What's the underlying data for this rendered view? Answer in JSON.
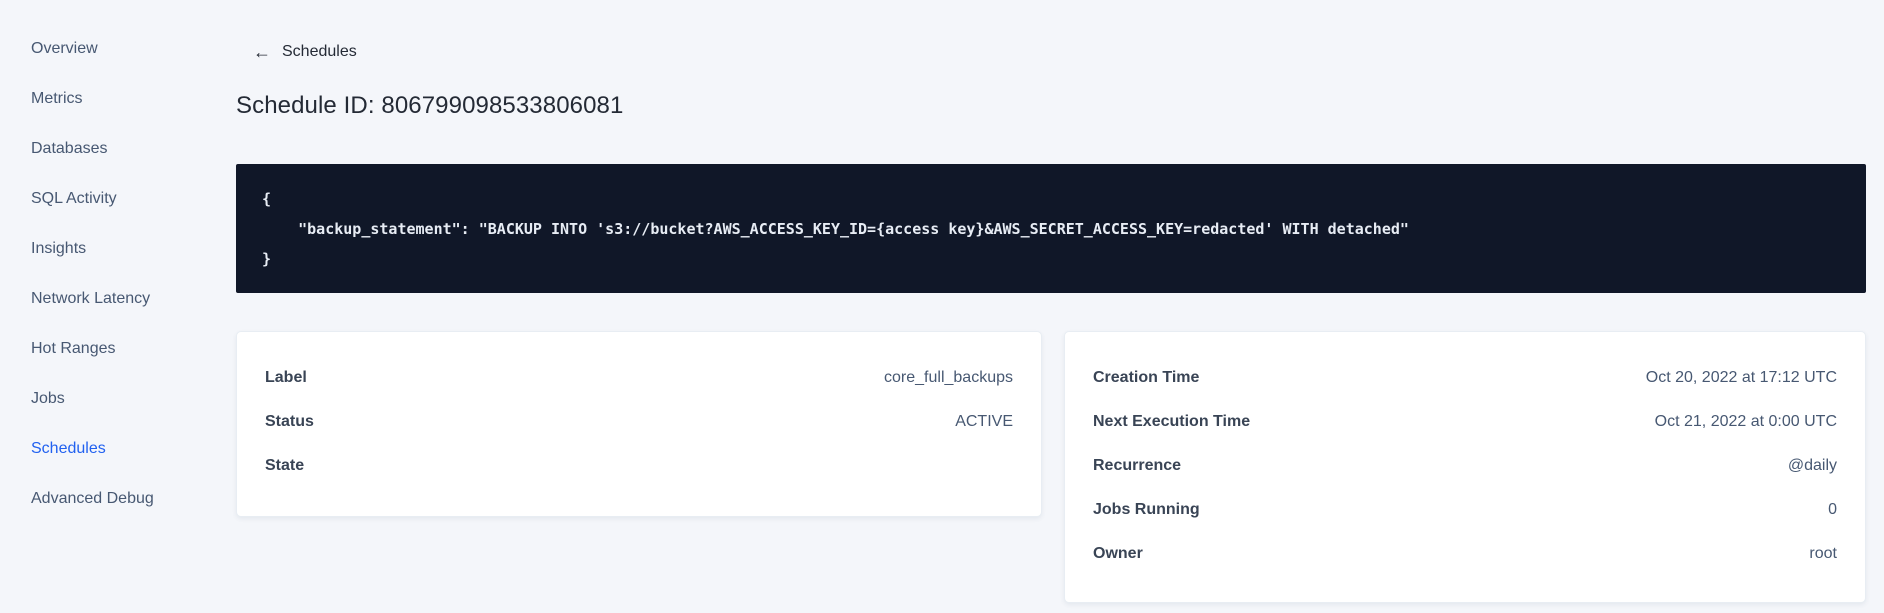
{
  "colors": {
    "accent": "#2161f0",
    "page-bg": "#f4f6fa",
    "code-bg": "#101728",
    "code-text": "#e7ecf4",
    "text-primary": "#242a35",
    "text-secondary": "#475872",
    "text-label": "#394455",
    "card-border": "#e8edf3"
  },
  "sidebar": {
    "items": [
      {
        "label": "Overview",
        "active": false
      },
      {
        "label": "Metrics",
        "active": false
      },
      {
        "label": "Databases",
        "active": false
      },
      {
        "label": "SQL Activity",
        "active": false
      },
      {
        "label": "Insights",
        "active": false
      },
      {
        "label": "Network Latency",
        "active": false
      },
      {
        "label": "Hot Ranges",
        "active": false
      },
      {
        "label": "Jobs",
        "active": false
      },
      {
        "label": "Schedules",
        "active": true
      },
      {
        "label": "Advanced Debug",
        "active": false
      }
    ]
  },
  "header": {
    "back_icon": "←",
    "back_label": "Schedules",
    "title": "Schedule ID: 806799098533806081"
  },
  "code_block": {
    "text": "{\n    \"backup_statement\": \"BACKUP INTO 's3://bucket?AWS_ACCESS_KEY_ID={access key}&AWS_SECRET_ACCESS_KEY=redacted' WITH detached\"\n}"
  },
  "schedule_details": {
    "rows": [
      {
        "label": "Label",
        "value": "core_full_backups"
      },
      {
        "label": "Status",
        "value": "ACTIVE"
      },
      {
        "label": "State",
        "value": ""
      }
    ]
  },
  "execution_details": {
    "rows": [
      {
        "label": "Creation Time",
        "value": "Oct 20, 2022 at 17:12 UTC"
      },
      {
        "label": "Next Execution Time",
        "value": "Oct 21, 2022 at 0:00 UTC"
      },
      {
        "label": "Recurrence",
        "value": "@daily"
      },
      {
        "label": "Jobs Running",
        "value": "0"
      },
      {
        "label": "Owner",
        "value": "root"
      }
    ]
  }
}
